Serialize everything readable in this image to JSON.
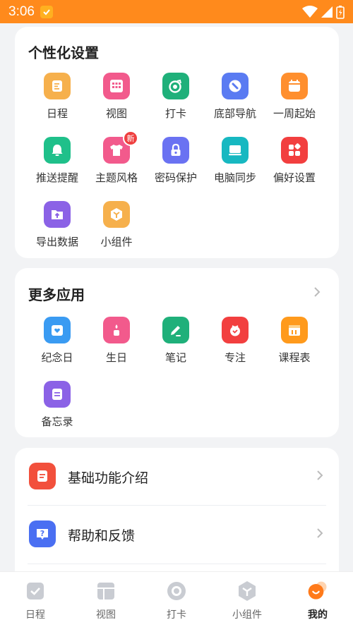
{
  "status_bar": {
    "time": "3:06"
  },
  "personalization": {
    "title": "个性化设置",
    "items": [
      {
        "label": "日程"
      },
      {
        "label": "视图"
      },
      {
        "label": "打卡"
      },
      {
        "label": "底部导航"
      },
      {
        "label": "一周起始"
      },
      {
        "label": "推送提醒"
      },
      {
        "label": "主题风格",
        "badge": "新"
      },
      {
        "label": "密码保护"
      },
      {
        "label": "电脑同步"
      },
      {
        "label": "偏好设置"
      },
      {
        "label": "导出数据"
      },
      {
        "label": "小组件"
      }
    ]
  },
  "more_apps": {
    "title": "更多应用",
    "items": [
      {
        "label": "纪念日"
      },
      {
        "label": "生日"
      },
      {
        "label": "笔记"
      },
      {
        "label": "专注"
      },
      {
        "label": "课程表"
      },
      {
        "label": "备忘录"
      }
    ]
  },
  "help_list": {
    "items": [
      {
        "label": "基础功能介绍"
      },
      {
        "label": "帮助和反馈"
      }
    ]
  },
  "tabbar": {
    "items": [
      {
        "label": "日程"
      },
      {
        "label": "视图"
      },
      {
        "label": "打卡"
      },
      {
        "label": "小组件"
      },
      {
        "label": "我的"
      }
    ],
    "active_index": 4
  },
  "colors": {
    "status_bar": "#ff8a1c",
    "accent": "#ff8a1c"
  }
}
